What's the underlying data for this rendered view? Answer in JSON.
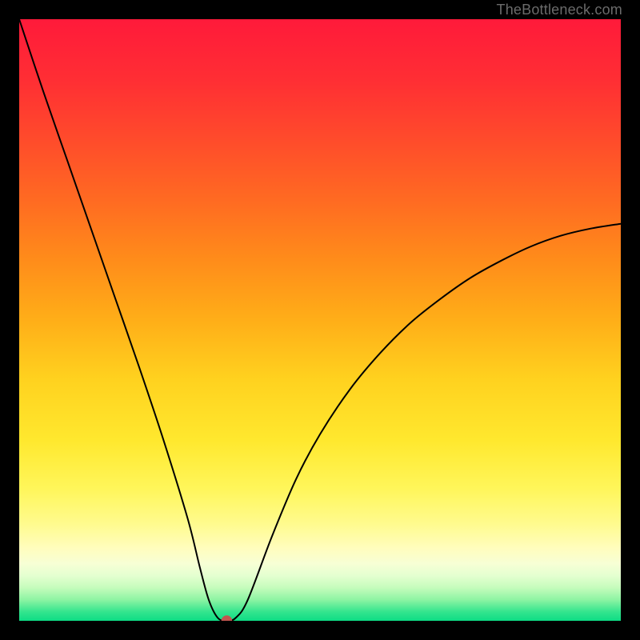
{
  "watermark": "TheBottleneck.com",
  "colors": {
    "frame": "#000000",
    "curve": "#000000",
    "dot": "#c1564f",
    "watermark": "#6b6b6b"
  },
  "gradient_stops": [
    {
      "offset": 0.0,
      "color": "#ff1a3a"
    },
    {
      "offset": 0.1,
      "color": "#ff2e34"
    },
    {
      "offset": 0.2,
      "color": "#ff4b2b"
    },
    {
      "offset": 0.3,
      "color": "#ff6a22"
    },
    {
      "offset": 0.4,
      "color": "#ff8c1a"
    },
    {
      "offset": 0.5,
      "color": "#ffae18"
    },
    {
      "offset": 0.6,
      "color": "#ffd21f"
    },
    {
      "offset": 0.7,
      "color": "#ffe82e"
    },
    {
      "offset": 0.78,
      "color": "#fff65a"
    },
    {
      "offset": 0.84,
      "color": "#fffb8f"
    },
    {
      "offset": 0.88,
      "color": "#fffdbe"
    },
    {
      "offset": 0.905,
      "color": "#f7ffd5"
    },
    {
      "offset": 0.925,
      "color": "#e4ffd0"
    },
    {
      "offset": 0.945,
      "color": "#c5fcbc"
    },
    {
      "offset": 0.965,
      "color": "#8df4a3"
    },
    {
      "offset": 0.985,
      "color": "#34e58e"
    },
    {
      "offset": 1.0,
      "color": "#0ddc85"
    }
  ],
  "chart_data": {
    "type": "line",
    "title": "",
    "xlabel": "",
    "ylabel": "",
    "xlim": [
      0,
      100
    ],
    "ylim": [
      0,
      100
    ],
    "min_marker": {
      "x": 34.5,
      "y": 0
    },
    "series": [
      {
        "name": "bottleneck-curve",
        "x": [
          0,
          4,
          8,
          12,
          16,
          20,
          24,
          28,
          30,
          31.5,
          33,
          34.5,
          36,
          38,
          42,
          46,
          50,
          55,
          60,
          65,
          70,
          75,
          80,
          85,
          90,
          95,
          100
        ],
        "y": [
          100,
          88,
          76.5,
          65,
          53.5,
          42,
          30,
          17,
          9,
          3.5,
          0.5,
          0,
          0.5,
          3.5,
          14,
          23.5,
          31,
          38.5,
          44.5,
          49.5,
          53.5,
          57,
          59.8,
          62.2,
          64,
          65.2,
          66
        ]
      }
    ]
  }
}
